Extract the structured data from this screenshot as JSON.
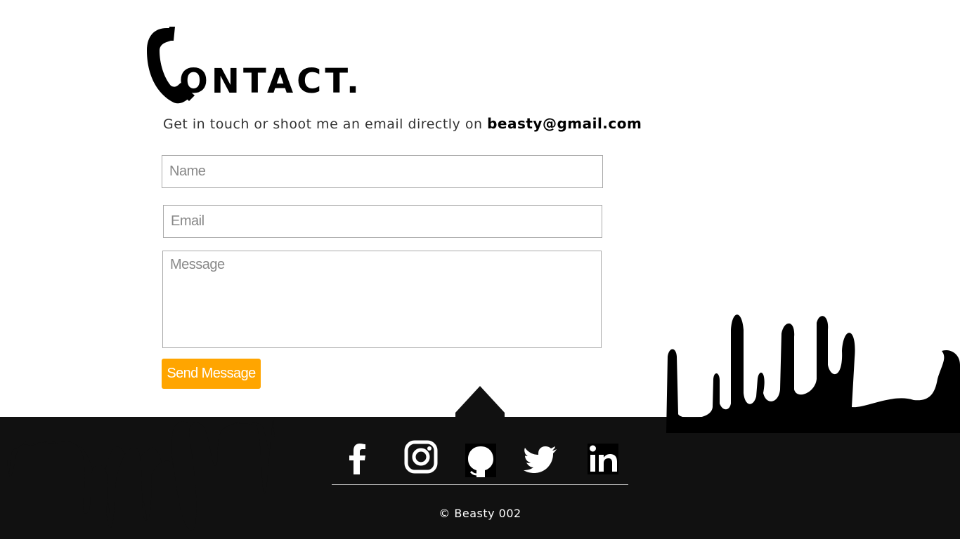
{
  "heading": {
    "text": "ONTACT.",
    "icon": "phone-handset-icon"
  },
  "intro": {
    "text": "Get in touch or shoot me an email directly on ",
    "email": "beasty@gmail.com"
  },
  "form": {
    "name_placeholder": "Name",
    "email_placeholder": "Email",
    "message_placeholder": "Message",
    "send_label": "Send Message"
  },
  "footer": {
    "socials": [
      {
        "name": "Facebook",
        "icon": "facebook-icon"
      },
      {
        "name": "Instagram",
        "icon": "instagram-icon"
      },
      {
        "name": "GitHub",
        "icon": "github-icon"
      },
      {
        "name": "Twitter",
        "icon": "twitter-icon"
      },
      {
        "name": "LinkedIn",
        "icon": "linkedin-icon"
      }
    ],
    "copyright": "© Beasty 002"
  },
  "colors": {
    "accent": "#ffa500",
    "footer_bg": "#111111",
    "text": "#333333"
  }
}
